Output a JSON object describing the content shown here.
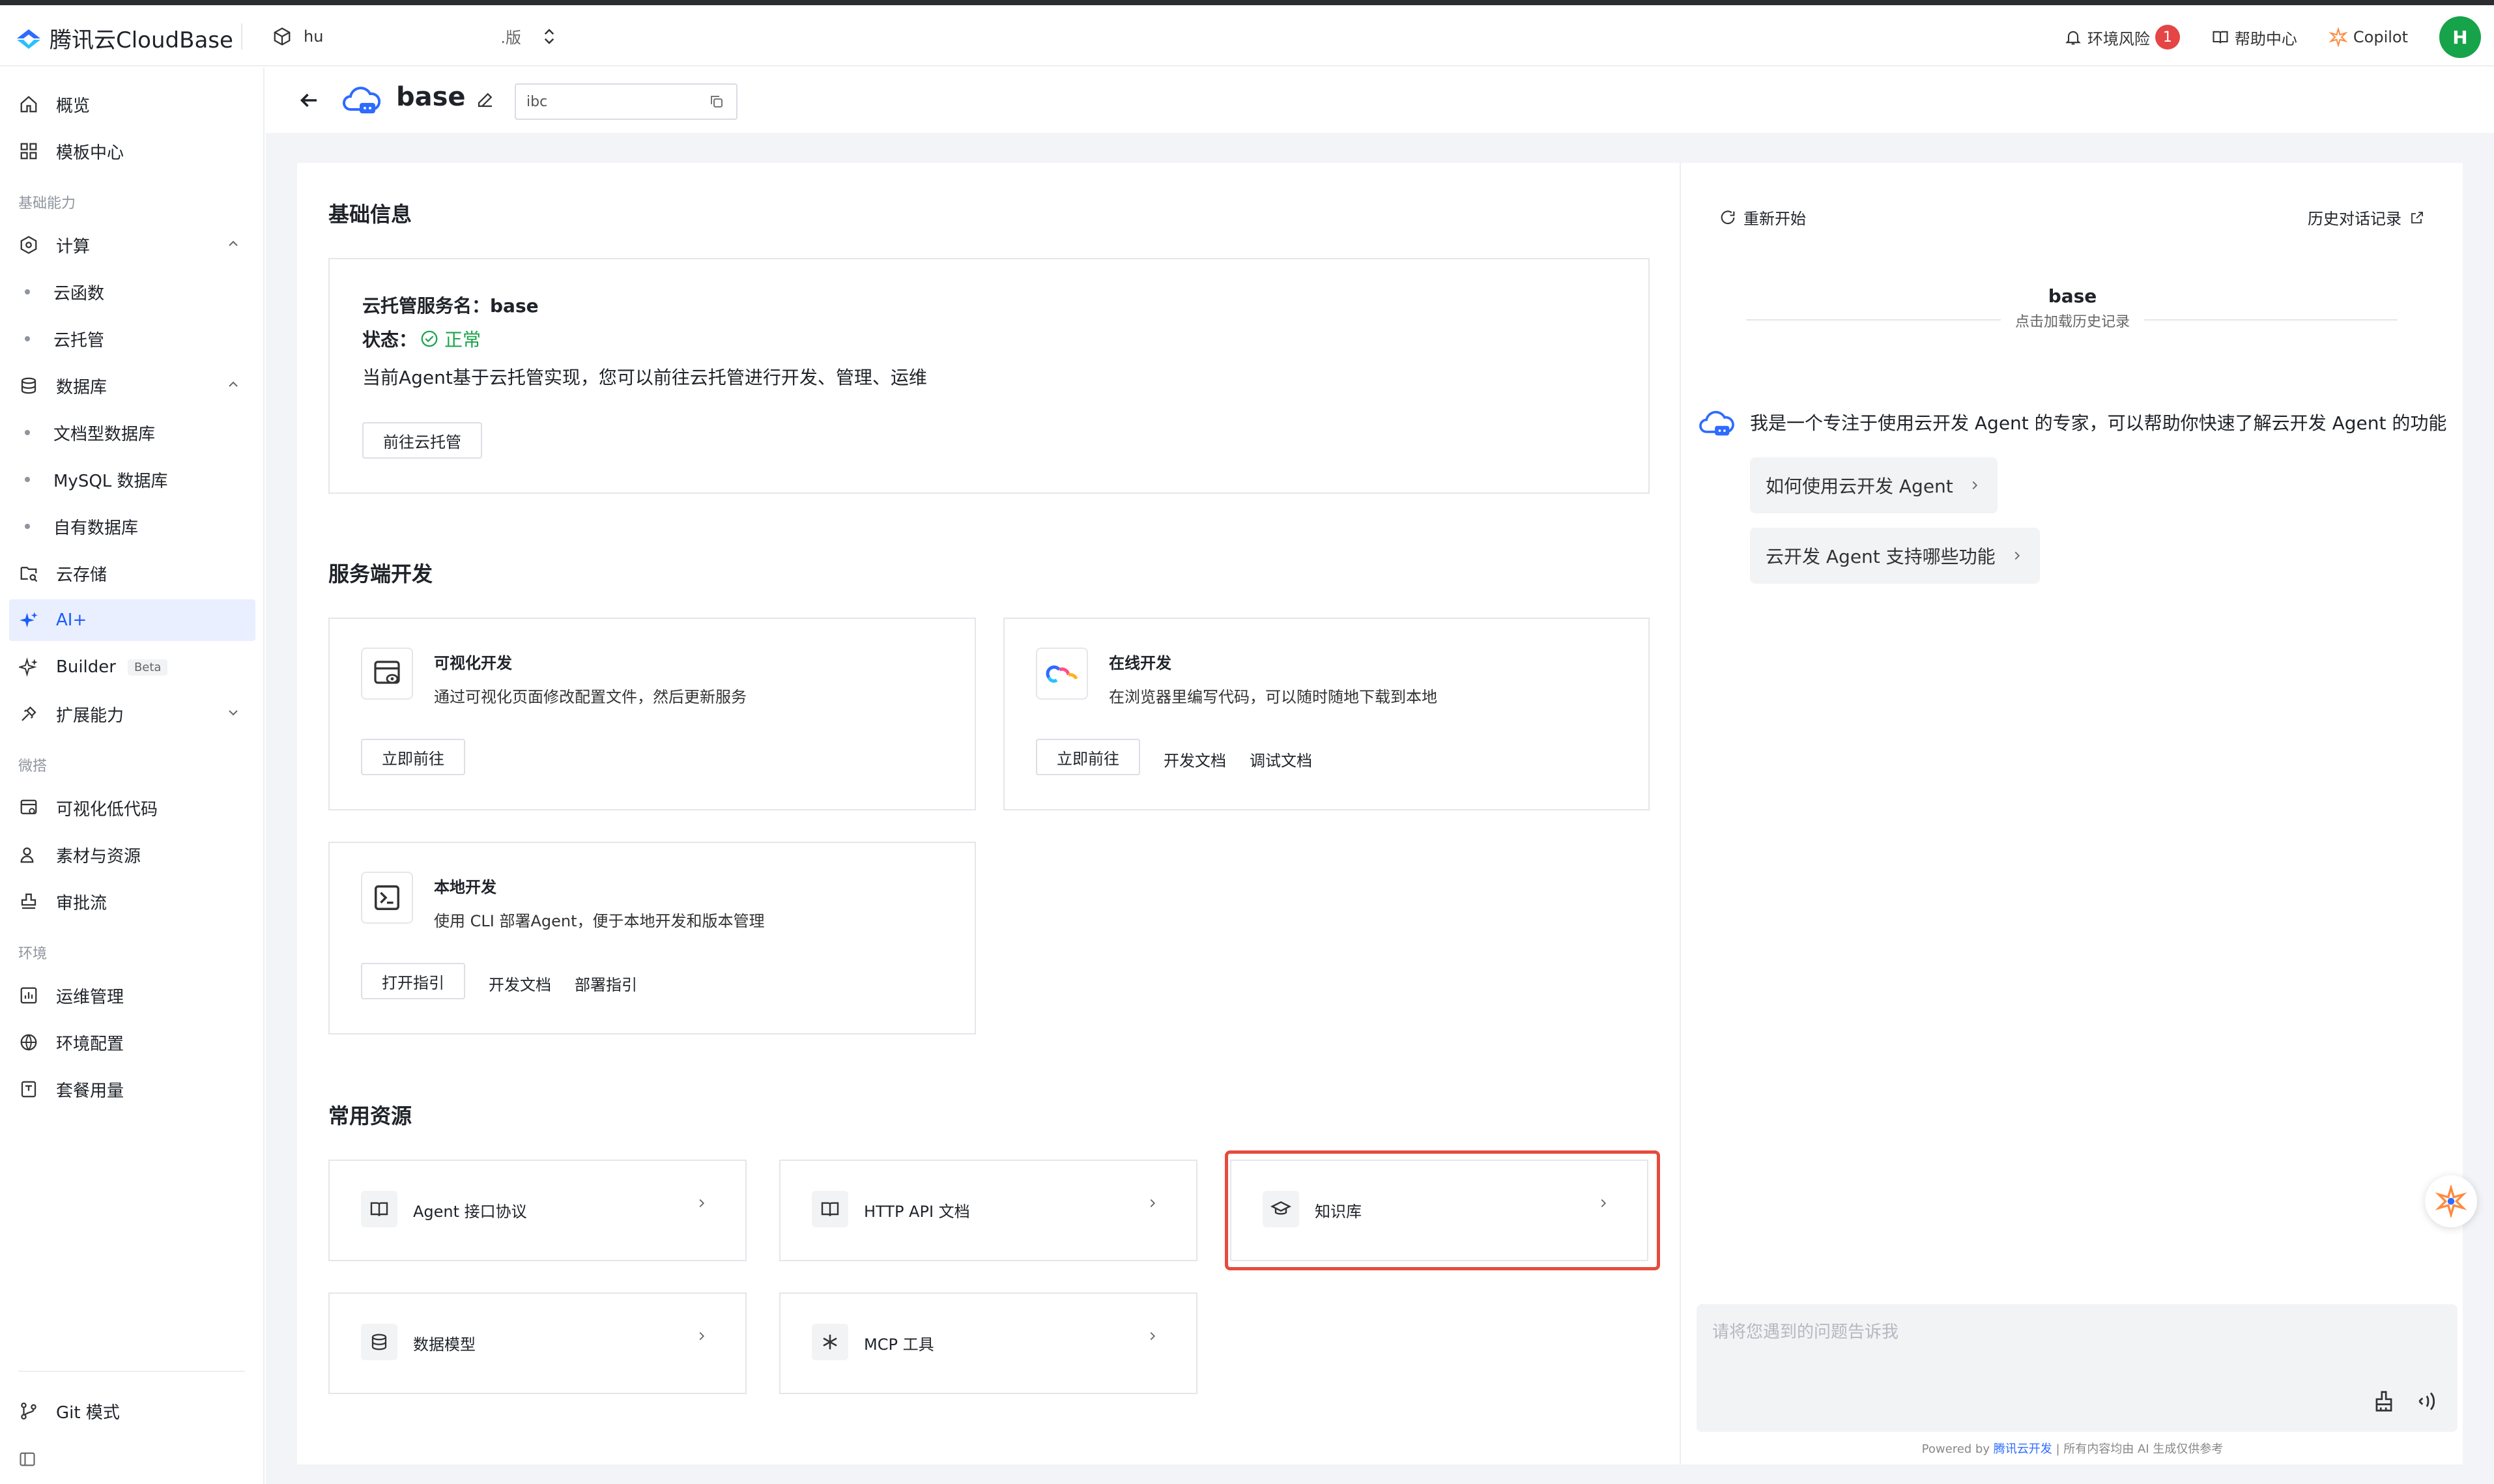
{
  "brand": {
    "name": "腾讯云CloudBase"
  },
  "env": {
    "name": "hu",
    "tag": ".版"
  },
  "topnav": {
    "risk_label": "环境风险",
    "risk_count": "1",
    "help_label": "帮助中心",
    "copilot_label": "Copilot",
    "avatar_initial": "H"
  },
  "sidebar": {
    "overview": "概览",
    "templates": "模板中心",
    "section_basic": "基础能力",
    "compute": "计算",
    "functions": "云函数",
    "cloudrun": "云托管",
    "database": "数据库",
    "doc_db": "文档型数据库",
    "mysql_db": "MySQL 数据库",
    "own_db": "自有数据库",
    "storage": "云存储",
    "ai": "AI+",
    "builder": "Builder",
    "builder_badge": "Beta",
    "extensions": "扩展能力",
    "section_weida": "微搭",
    "lowcode": "可视化低代码",
    "assets": "素材与资源",
    "approval": "审批流",
    "section_env": "环境",
    "ops": "运维管理",
    "env_config": "环境配置",
    "usage": "套餐用量",
    "git_mode": "Git 模式"
  },
  "page": {
    "service_name": "base",
    "id_value": "ibc"
  },
  "basic": {
    "title": "基础信息",
    "service_line_label": "云托管服务名：",
    "service_line_value": "base",
    "status_label": "状态：",
    "status_value": "正常",
    "desc": "当前Agent基于云托管实现，您可以前往云托管进行开发、管理、运维",
    "goto_btn": "前往云托管"
  },
  "server_dev": {
    "title": "服务端开发",
    "cards": [
      {
        "title": "可视化开发",
        "desc": "通过可视化页面修改配置文件，然后更新服务",
        "btn": "立即前往"
      },
      {
        "title": "在线开发",
        "desc": "在浏览器里编写代码，可以随时随地下载到本地",
        "btn": "立即前往",
        "link1": "开发文档",
        "link2": "调试文档"
      },
      {
        "title": "本地开发",
        "desc": "使用 CLI 部署Agent，便于本地开发和版本管理",
        "btn": "打开指引",
        "link1": "开发文档",
        "link2": "部署指引"
      }
    ]
  },
  "resources": {
    "title": "常用资源",
    "items": [
      "Agent 接口协议",
      "HTTP API 文档",
      "知识库",
      "数据模型",
      "MCP 工具"
    ]
  },
  "chat": {
    "restart": "重新开始",
    "history": "历史对话记录",
    "agent_name": "base",
    "load_history": "点击加载历史记录",
    "greeting": "我是一个专注于使用云开发 Agent 的专家，可以帮助你快速了解云开发 Agent 的功能",
    "suggestions": [
      "如何使用云开发 Agent",
      "云开发 Agent 支持哪些功能"
    ],
    "input_placeholder": "请将您遇到的问题告诉我",
    "powered_prefix": "Powered by",
    "powered_brand": "腾讯云开发",
    "powered_suffix": "| 所有内容均由 AI 生成仅供参考"
  }
}
